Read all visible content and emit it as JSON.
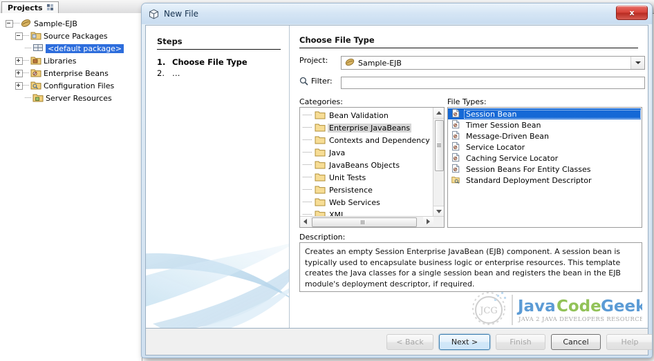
{
  "ide": {
    "tab": {
      "label": "Projects",
      "close_glyph": "✕",
      "icon": "close-tab-icon"
    },
    "tree": {
      "root": {
        "label": "Sample-EJB",
        "icon": "coffee-bean-icon",
        "expander": "minus"
      },
      "nodes": [
        {
          "label": "Source Packages",
          "icon": "source-packages-folder-icon",
          "expander": "minus",
          "depth": 1
        },
        {
          "label": "<default package>",
          "icon": "package-icon",
          "expander": "none",
          "depth": 2,
          "selected": true
        },
        {
          "label": "Libraries",
          "icon": "libraries-folder-icon",
          "expander": "plus",
          "depth": 1
        },
        {
          "label": "Enterprise Beans",
          "icon": "enterprise-beans-folder-icon",
          "expander": "plus",
          "depth": 1
        },
        {
          "label": "Configuration Files",
          "icon": "configuration-files-folder-icon",
          "expander": "plus",
          "depth": 1
        },
        {
          "label": "Server Resources",
          "icon": "server-resources-folder-icon",
          "expander": "none",
          "depth": 1
        }
      ]
    }
  },
  "dialog": {
    "title": "New File",
    "title_icon": "new-file-cube-icon",
    "close_label": "x",
    "steps": {
      "heading": "Steps",
      "items": [
        {
          "num": "1.",
          "label": "Choose File Type",
          "active": true
        },
        {
          "num": "2.",
          "label": "…",
          "active": false
        }
      ]
    },
    "content": {
      "heading": "Choose File Type",
      "project_label": "Project:",
      "project_value": "Sample-EJB",
      "project_icon": "coffee-bean-icon",
      "dropdown_icon": "chevron-down-icon",
      "filter_label": "Filter:",
      "filter_value": "",
      "filter_placeholder": "",
      "filter_icon": "search-icon",
      "categories_label": "Categories:",
      "categories": [
        {
          "label": "Bean Validation",
          "selected": false
        },
        {
          "label": "Enterprise JavaBeans",
          "selected": true
        },
        {
          "label": "Contexts and Dependency Inj",
          "selected": false
        },
        {
          "label": "Java",
          "selected": false
        },
        {
          "label": "JavaBeans Objects",
          "selected": false
        },
        {
          "label": "Unit Tests",
          "selected": false
        },
        {
          "label": "Persistence",
          "selected": false
        },
        {
          "label": "Web Services",
          "selected": false
        },
        {
          "label": "XML",
          "selected": false
        }
      ],
      "file_types_label": "File Types:",
      "file_types": [
        {
          "label": "Session Bean",
          "selected": true,
          "icon": "session-bean-icon"
        },
        {
          "label": "Timer Session Bean",
          "selected": false,
          "icon": "session-bean-icon"
        },
        {
          "label": "Message-Driven Bean",
          "selected": false,
          "icon": "session-bean-icon"
        },
        {
          "label": "Service Locator",
          "selected": false,
          "icon": "session-bean-icon"
        },
        {
          "label": "Caching Service Locator",
          "selected": false,
          "icon": "session-bean-icon"
        },
        {
          "label": "Session Beans For Entity Classes",
          "selected": false,
          "icon": "session-bean-icon"
        },
        {
          "label": "Standard Deployment Descriptor",
          "selected": false,
          "icon": "deployment-descriptor-icon"
        }
      ],
      "description_label": "Description:",
      "description_text": "Creates an empty Session Enterprise JavaBean (EJB) component. A session bean is typically used to encapsulate business logic or enterprise resources. This template creates the Java classes for a single session bean and registers the bean in the EJB module's deployment descriptor, if required."
    },
    "footer": {
      "back": "< Back",
      "next": "Next >",
      "finish": "Finish",
      "cancel": "Cancel",
      "help": "Help"
    }
  },
  "watermark": {
    "word1": "Java",
    "word2": "Code",
    "word3": "Geeks",
    "tagline": "JAVA 2 JAVA DEVELOPERS RESOURCE CENTER",
    "mark": "JCG"
  },
  "colors": {
    "selection_blue": "#1569d6",
    "tree_selection": "#2d6ddc",
    "category_selection": "#d6d6d6",
    "title_bar": "#d6e6f5",
    "close_red": "#d8453b",
    "default_button_border": "#3c7fb1",
    "watermark_blue": "#5b9bd5",
    "watermark_green": "#92c258"
  }
}
